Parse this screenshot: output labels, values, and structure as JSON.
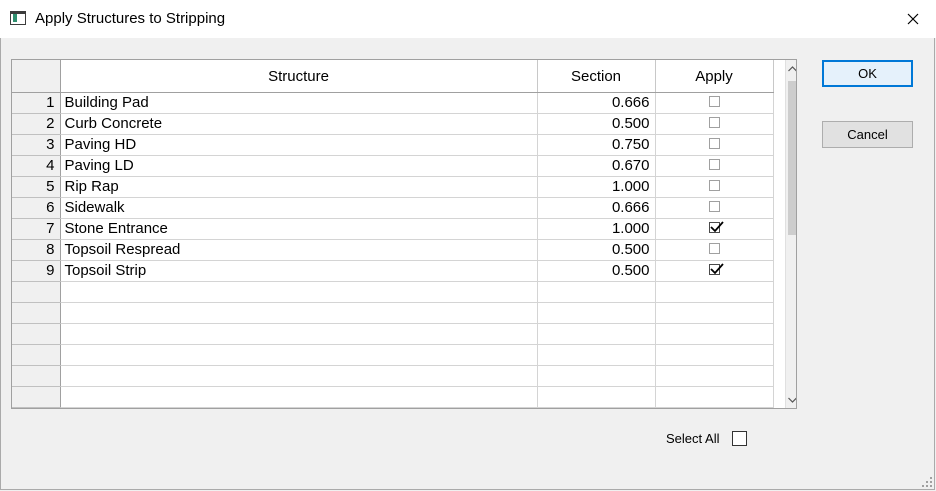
{
  "window": {
    "title": "Apply Structures to Stripping"
  },
  "grid": {
    "columns": {
      "structure": "Structure",
      "section": "Section",
      "apply": "Apply"
    },
    "rows": [
      {
        "num": "1",
        "structure": "Building Pad",
        "section": "0.666",
        "apply": false
      },
      {
        "num": "2",
        "structure": "Curb Concrete",
        "section": "0.500",
        "apply": false
      },
      {
        "num": "3",
        "structure": "Paving HD",
        "section": "0.750",
        "apply": false
      },
      {
        "num": "4",
        "structure": "Paving LD",
        "section": "0.670",
        "apply": false
      },
      {
        "num": "5",
        "structure": "Rip Rap",
        "section": "1.000",
        "apply": false
      },
      {
        "num": "6",
        "structure": "Sidewalk",
        "section": "0.666",
        "apply": false
      },
      {
        "num": "7",
        "structure": "Stone Entrance",
        "section": "1.000",
        "apply": true
      },
      {
        "num": "8",
        "structure": "Topsoil Respread",
        "section": "0.500",
        "apply": false
      },
      {
        "num": "9",
        "structure": "Topsoil Strip",
        "section": "0.500",
        "apply": true
      }
    ],
    "empty_rows": 6
  },
  "buttons": {
    "ok": "OK",
    "cancel": "Cancel"
  },
  "select_all": {
    "label": "Select All",
    "checked": false
  }
}
